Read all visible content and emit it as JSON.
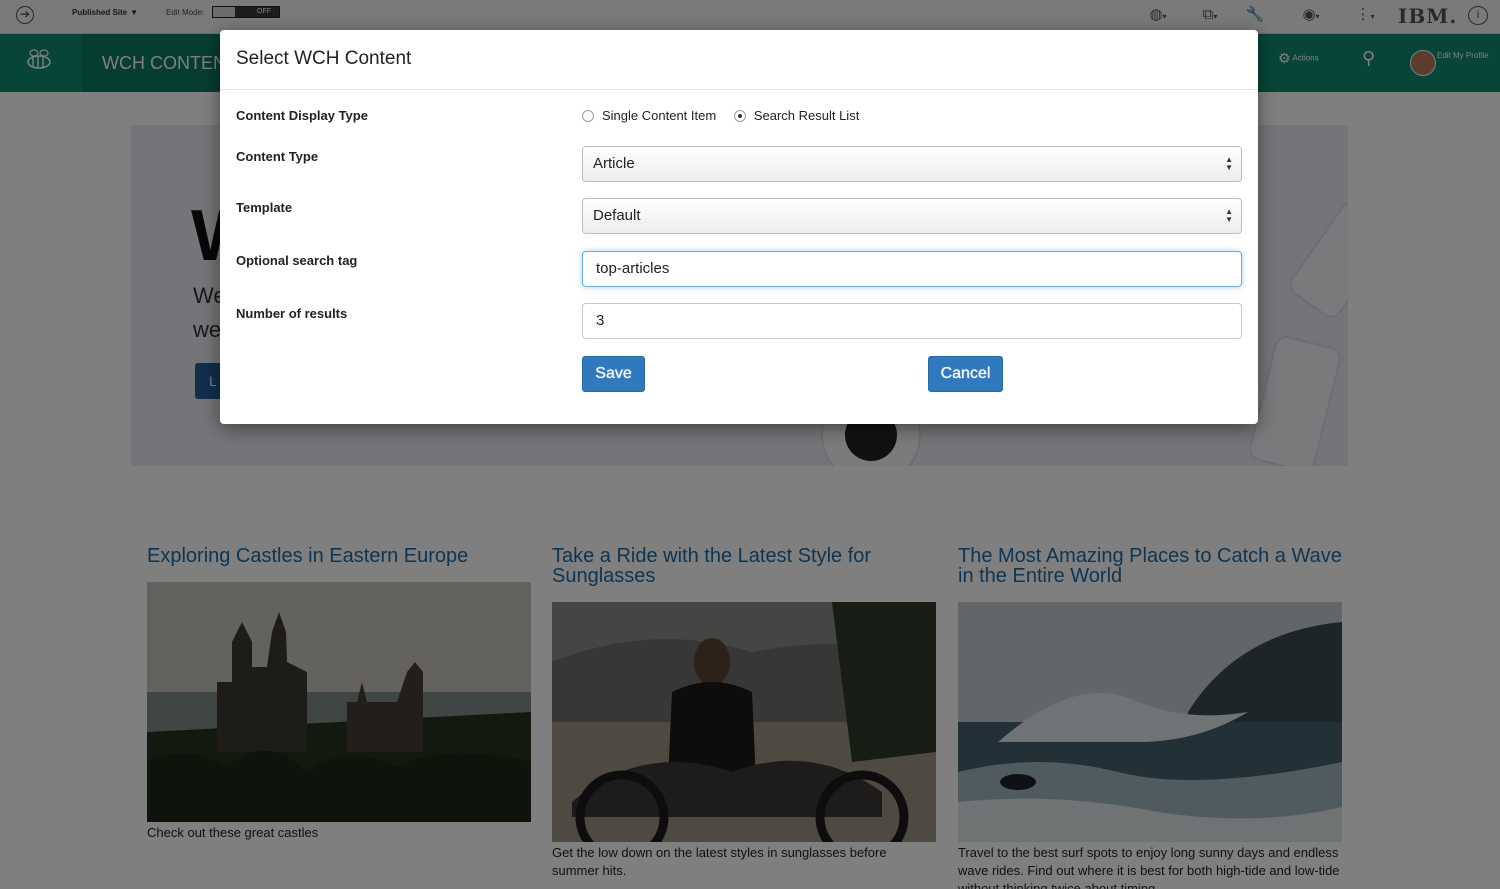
{
  "toolbar": {
    "site_selector": "Published Site",
    "edit_mode_label": "Edit Mode:",
    "edit_mode_state": "OFF",
    "brand": "IBM."
  },
  "header": {
    "brand": "WCH CONTENT",
    "actions_label": "Actions",
    "profile_label": "Edit My Profile"
  },
  "hero": {
    "title_fragment": "W",
    "line1_fragment": "We",
    "line2_fragment": "we",
    "button_fragment": "L"
  },
  "articles": [
    {
      "title": "Exploring Castles in Eastern Europe",
      "caption": "Check out these great castles"
    },
    {
      "title": "Take a Ride with the Latest Style for Sunglasses",
      "caption": "Get the low down on the latest styles in sunglasses before summer hits."
    },
    {
      "title": "The Most Amazing Places to Catch a Wave in the Entire World",
      "caption": "Travel to the best surf spots to enjoy long sunny days and endless wave rides. Find out where it is best for both high-tide and low-tide without thinking twice about timing."
    }
  ],
  "modal": {
    "title": "Select WCH Content",
    "display_type_label": "Content Display Type",
    "display_options": [
      {
        "label": "Single Content Item",
        "selected": false
      },
      {
        "label": "Search Result List",
        "selected": true
      }
    ],
    "content_type_label": "Content Type",
    "content_type_value": "Article",
    "template_label": "Template",
    "template_value": "Default",
    "search_tag_label": "Optional search tag",
    "search_tag_value": "top-articles",
    "num_results_label": "Number of results",
    "num_results_value": "3",
    "save_label": "Save",
    "cancel_label": "Cancel"
  },
  "colors": {
    "header_green": "#0d8a6e",
    "primary_button": "#2f7abf",
    "link_blue": "#1d6aa5"
  }
}
